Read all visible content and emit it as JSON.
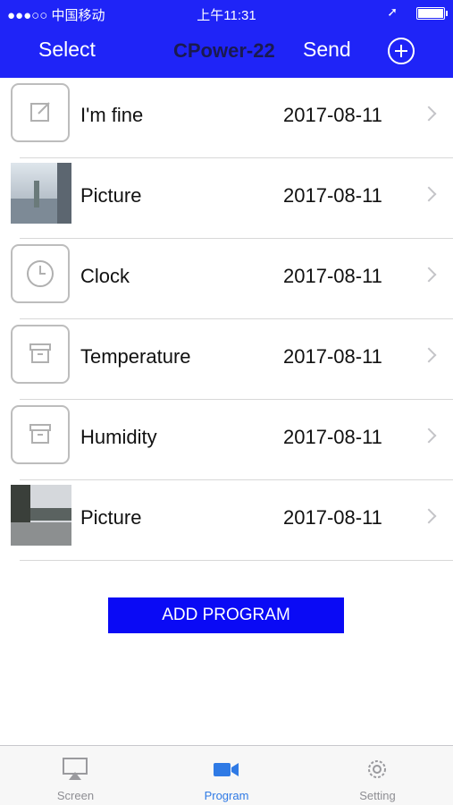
{
  "status_bar": {
    "carrier": "●●●○○ 中国移动 ︎",
    "time": "上午11:31",
    "location_icon": "location-arrow-icon"
  },
  "nav": {
    "select": "Select",
    "title": "CPower-22",
    "send": "Send",
    "add_icon": "plus-circle-icon"
  },
  "programs": [
    {
      "name": "I'm fine",
      "date": "2017-08-11",
      "icon": "edit-icon"
    },
    {
      "name": "Picture",
      "date": "2017-08-11",
      "icon": "photo-thumbnail"
    },
    {
      "name": "Clock",
      "date": "2017-08-11",
      "icon": "clock-icon"
    },
    {
      "name": "Temperature",
      "date": "2017-08-11",
      "icon": "archive-icon"
    },
    {
      "name": "Humidity",
      "date": "2017-08-11",
      "icon": "archive-icon"
    },
    {
      "name": "Picture",
      "date": "2017-08-11",
      "icon": "photo-thumbnail"
    }
  ],
  "add_program": "ADD PROGRAM",
  "tabs": [
    {
      "label": "Screen",
      "icon": "airplay-icon",
      "active": false
    },
    {
      "label": "Program",
      "icon": "video-camera-icon",
      "active": true
    },
    {
      "label": "Setting",
      "icon": "gear-icon",
      "active": false
    }
  ],
  "colors": {
    "nav_bar": "#1f24f7",
    "add_button": "#0a0af5",
    "active_tab": "#2f7ae5"
  }
}
